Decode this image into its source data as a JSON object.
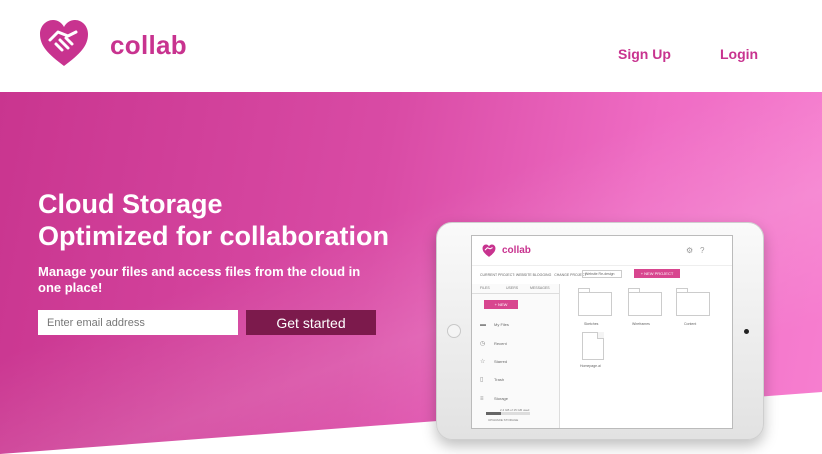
{
  "colors": {
    "brand": "#c8338f",
    "cta": "#7c1a4c",
    "hero_start": "#c9358f",
    "hero_end": "#f77fd0"
  },
  "header": {
    "logo_icon": "heart-handshake-icon",
    "brand": "collab",
    "nav": [
      {
        "label": "Sign Up"
      },
      {
        "label": "Login"
      }
    ]
  },
  "hero": {
    "title_line1": "Cloud Storage",
    "title_line2": "Optimized for collaboration",
    "subtitle": "Manage your files and access files from the cloud in one place!",
    "email_placeholder": "Enter email address",
    "cta_label": "Get started"
  },
  "mockup": {
    "brand": "collab",
    "project_label": "CURRENT PROJECT: WEBSITE BLOGGING",
    "change_project": "CHANGE PROJECT",
    "project_select": "Website Re-design",
    "new_project": "+ NEW PROJECT",
    "tabs": [
      "FILES",
      "USERS",
      "MESSAGES"
    ],
    "new_button": "+ NEW",
    "sidebar": [
      {
        "label": "My Files",
        "icon": "folder-icon"
      },
      {
        "label": "Recent",
        "icon": "clock-icon"
      },
      {
        "label": "Starred",
        "icon": "star-icon"
      },
      {
        "label": "Trash",
        "icon": "trash-icon"
      },
      {
        "label": "Storage",
        "icon": "storage-icon"
      }
    ],
    "storage_usage": "2.4 GB of 15 GB used",
    "storage_used_fraction": 0.35,
    "upgrade": "UPGRADE STORAGE",
    "folders": [
      {
        "label": "Sketches"
      },
      {
        "label": "Wireframes"
      },
      {
        "label": "Content"
      }
    ],
    "files": [
      {
        "label": "Homepage.ai"
      }
    ]
  }
}
